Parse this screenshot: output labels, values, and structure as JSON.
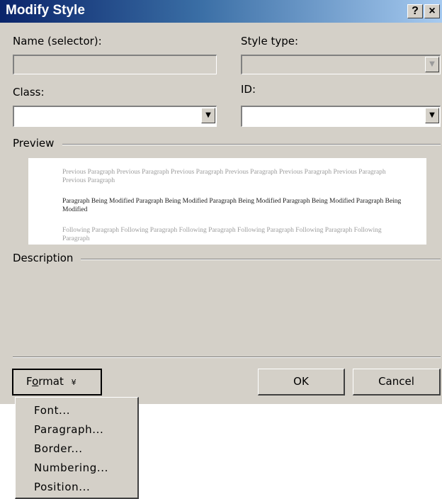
{
  "window": {
    "title": "Modify Style",
    "help_glyph": "?",
    "close_glyph": "×"
  },
  "fields": {
    "name_label": "Name (selector):",
    "name_value": "",
    "style_type_label": "Style type:",
    "style_type_value": "",
    "class_label": "Class:",
    "class_value": "",
    "id_label": "ID:",
    "id_value": ""
  },
  "preview": {
    "label": "Preview",
    "previous_paragraph": "Previous Paragraph Previous Paragraph Previous Paragraph Previous Paragraph Previous Paragraph Previous Paragraph Previous Paragraph",
    "modified_paragraph": "Paragraph Being Modified Paragraph Being Modified Paragraph Being Modified Paragraph Being Modified Paragraph Being Modified",
    "following_paragraph": "Following Paragraph Following Paragraph Following Paragraph Following Paragraph Following Paragraph Following Paragraph"
  },
  "description": {
    "label": "Description",
    "text": ""
  },
  "buttons": {
    "format_label_pre": "F",
    "format_label_underlined": "o",
    "format_label_post": "rmat",
    "format_arrow": "¥",
    "ok": "OK",
    "cancel": "Cancel"
  },
  "format_menu": {
    "items": [
      "Font...",
      "Paragraph...",
      "Border...",
      "Numbering...",
      "Position..."
    ]
  },
  "colors": {
    "dialog_bg": "#d4d0c8",
    "title_gradient_start": "#0a246a",
    "title_gradient_end": "#a6caf0"
  }
}
